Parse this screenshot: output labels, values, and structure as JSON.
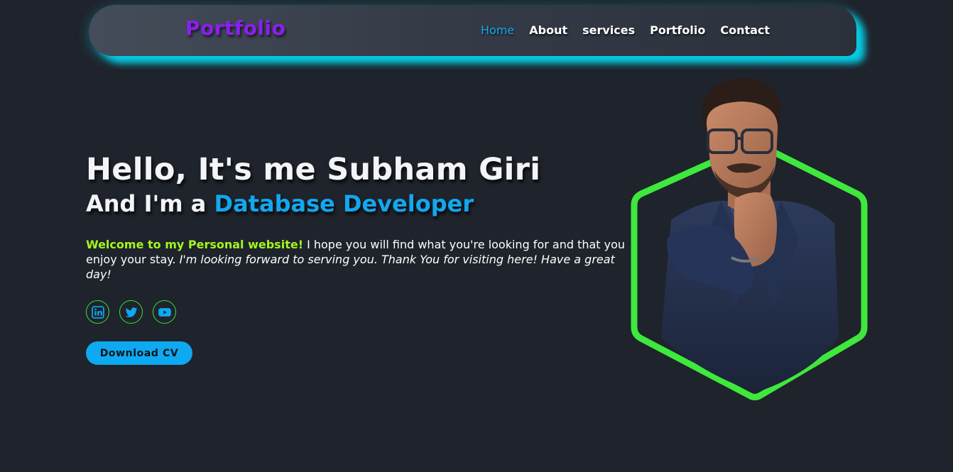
{
  "nav": {
    "logo": "Portfolio",
    "links": [
      {
        "label": "Home",
        "active": true
      },
      {
        "label": "About"
      },
      {
        "label": "services"
      },
      {
        "label": "Portfolio"
      },
      {
        "label": "Contact"
      }
    ]
  },
  "hero": {
    "title": "Hello, It's me Subham Giri",
    "subtitle_prefix": "And I'm a ",
    "role": "Database Developer",
    "intro_welcome": "Welcome to my Personal website!",
    "intro_body": " I hope you will find what you're looking for and that you enjoy your stay. ",
    "intro_italic": "I'm looking forward to serving you. Thank You for visiting here! Have a great day!",
    "socials": [
      {
        "icon": "linkedin-icon"
      },
      {
        "icon": "twitter-icon"
      },
      {
        "icon": "youtube-icon"
      }
    ],
    "cv_button": "Download CV"
  },
  "colors": {
    "background": "#1f232b",
    "accent_blue": "#12a7ef",
    "accent_purple": "#8a1ef0",
    "accent_green": "#a5f51e",
    "hexagon_green": "#3ee83c",
    "nav_glow": "#00e6ff"
  }
}
